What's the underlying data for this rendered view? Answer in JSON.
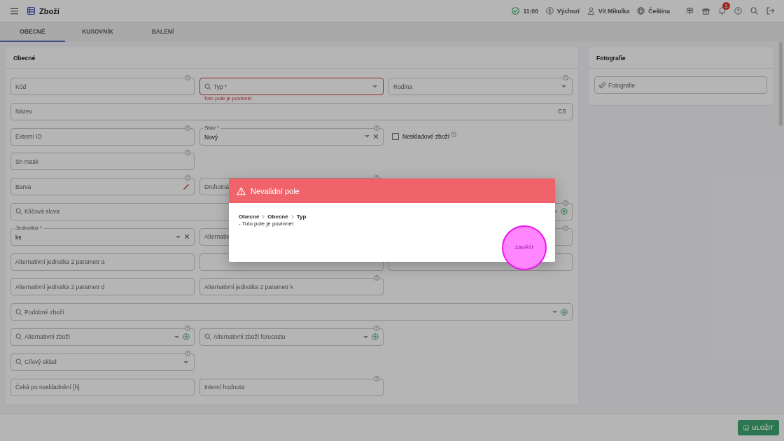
{
  "header": {
    "title": "Zboží",
    "status": [
      {
        "kind": "status",
        "text": "11:00"
      },
      {
        "kind": "currency",
        "text": "Výchozí"
      },
      {
        "kind": "user",
        "text": "Vít Mikulka"
      },
      {
        "kind": "language",
        "text": "Čeština"
      }
    ],
    "icons": [
      {
        "kind": "signpost"
      },
      {
        "kind": "gift"
      },
      {
        "kind": "bell",
        "badge": "1"
      },
      {
        "kind": "help"
      },
      {
        "kind": "search"
      },
      {
        "kind": "logout"
      }
    ]
  },
  "tabs": [
    {
      "label": "OBECNÉ",
      "selected": true
    },
    {
      "label": "KUSOVNÍK",
      "selected": false
    },
    {
      "label": "BALENÍ",
      "selected": false
    }
  ],
  "general": {
    "title": "Obecné",
    "rows": [
      {
        "fields": [
          {
            "kind": "input",
            "label": "Kód",
            "help": true
          },
          {
            "kind": "select",
            "label": "Typ",
            "required_mark": "*",
            "search": true,
            "error": "Toto pole je povinné!"
          },
          {
            "kind": "select",
            "label": "Rodina",
            "help": true
          }
        ]
      },
      {
        "fields": [
          {
            "kind": "input",
            "label": "Název",
            "wide": true,
            "suffix": "CS"
          }
        ]
      },
      {
        "fields": [
          {
            "kind": "input",
            "label": "Externí ID",
            "help": true
          },
          {
            "kind": "select",
            "floating_label": "Stav",
            "required_mark": "*",
            "value": "Nový",
            "clearable": true,
            "help": true
          },
          {
            "kind": "checkbox",
            "label": "Neskladové zboží",
            "checked": false,
            "help": true
          }
        ]
      },
      {
        "fields": [
          {
            "kind": "input",
            "label": "Sn mask",
            "help": true
          }
        ]
      },
      {
        "fields": [
          {
            "kind": "color",
            "label": "Barva",
            "help": true
          },
          {
            "kind": "input",
            "label": "Druhotná",
            "help": true
          }
        ]
      },
      {
        "fields": [
          {
            "kind": "select",
            "label": "Klíčová slova",
            "search": true,
            "wide": true,
            "add": true,
            "help": true
          }
        ]
      },
      {
        "fields": [
          {
            "kind": "select",
            "floating_label": "Jednotka",
            "required_mark": "*",
            "value": "ks",
            "clearable": true
          },
          {
            "kind": "input",
            "label": "Alternativ"
          },
          {
            "kind": "input",
            "help": true
          }
        ]
      },
      {
        "fields": [
          {
            "kind": "input",
            "label": "Alternativní jednotka 2 parametr a"
          },
          {
            "kind": "input"
          },
          {
            "kind": "input"
          }
        ]
      },
      {
        "fields": [
          {
            "kind": "input",
            "label": "Alternativní jednotka 2 parametr d"
          },
          {
            "kind": "input",
            "label": "Alternativní jednotka 2 parametr k",
            "help": true
          }
        ]
      },
      {
        "fields": [
          {
            "kind": "select",
            "label": "Podobné zboží",
            "search": true,
            "wide": true,
            "add": true
          }
        ]
      },
      {
        "fields": [
          {
            "kind": "select",
            "label": "Alternativní zboží",
            "search": true,
            "add": true,
            "help": true
          },
          {
            "kind": "select",
            "label": "Alternativní zboží forecastu",
            "search": true,
            "add": true,
            "help": true
          }
        ]
      },
      {
        "fields": [
          {
            "kind": "select",
            "label": "Cílový sklad",
            "search": true,
            "help": true
          }
        ]
      },
      {
        "fields": [
          {
            "kind": "input",
            "label": "Čeká po naskladnění [h]"
          },
          {
            "kind": "input",
            "label": "Interní hodnota",
            "help": true
          }
        ]
      }
    ]
  },
  "photos": {
    "title": "Fotografie",
    "field": "Fotografie"
  },
  "save_button": "ULOŽIT",
  "dialog": {
    "title": "Nevalidní pole",
    "path": [
      "Obecné",
      "Obecné",
      "Typ"
    ],
    "message": "- Toto pole je povinné!",
    "button": "ZAVŘÍT",
    "click_highlight": true
  }
}
